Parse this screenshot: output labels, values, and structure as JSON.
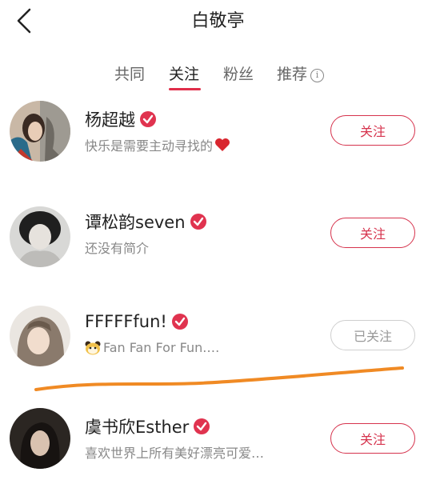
{
  "header": {
    "title": "白敬亭"
  },
  "tabs": [
    {
      "label": "共同",
      "active": false
    },
    {
      "label": "关注",
      "active": true
    },
    {
      "label": "粉丝",
      "active": false
    },
    {
      "label": "推荐",
      "active": false,
      "icon": "info-icon"
    }
  ],
  "users": [
    {
      "name": "杨超越",
      "bio": "快乐是需要主动寻找的",
      "bio_emoji": "heart-icon",
      "verified": true,
      "button": "关注",
      "followed": false
    },
    {
      "name": "谭松韵seven",
      "bio": "还没有简介",
      "verified": true,
      "button": "关注",
      "followed": false
    },
    {
      "name": "FFFFFfun!",
      "bio": "Fan Fan For Fun.…",
      "bio_emoji": "panda-icon",
      "verified": true,
      "button": "已关注",
      "followed": true
    },
    {
      "name": "虞书欣Esther",
      "bio": "喜欢世界上所有美好漂亮可爱…",
      "verified": true,
      "button": "关注",
      "followed": false
    }
  ],
  "colors": {
    "accent": "#d6334d",
    "annotation": "#f08a24"
  }
}
